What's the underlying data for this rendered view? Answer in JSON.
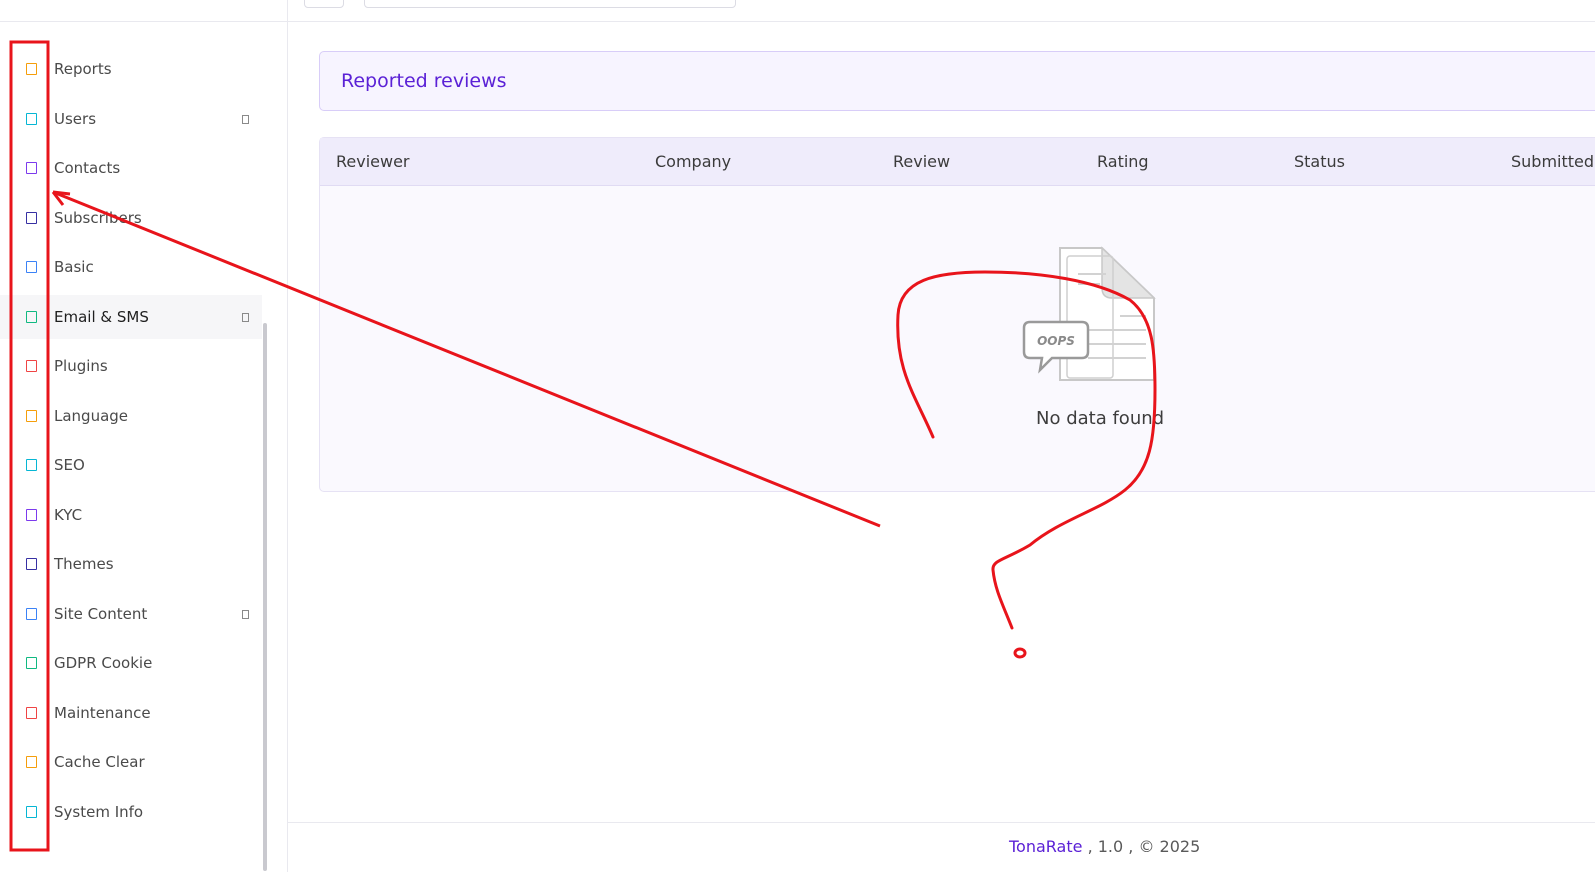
{
  "sidebar": {
    "items": [
      {
        "label": "Reports",
        "color": "#f59e0b"
      },
      {
        "label": "Users",
        "color": "#06b6d4",
        "has_submenu": true
      },
      {
        "label": "Contacts",
        "color": "#7c3aed"
      },
      {
        "label": "Subscribers",
        "color": "#3730a3"
      },
      {
        "label": "Basic",
        "color": "#3b82f6"
      },
      {
        "label": "Email & SMS",
        "color": "#10b981",
        "has_submenu": true,
        "active": true
      },
      {
        "label": "Plugins",
        "color": "#ef4444"
      },
      {
        "label": "Language",
        "color": "#f59e0b"
      },
      {
        "label": "SEO",
        "color": "#06b6d4"
      },
      {
        "label": "KYC",
        "color": "#7c3aed"
      },
      {
        "label": "Themes",
        "color": "#3730a3"
      },
      {
        "label": "Site Content",
        "color": "#3b82f6",
        "has_submenu": true
      },
      {
        "label": "GDPR Cookie",
        "color": "#10b981"
      },
      {
        "label": "Maintenance",
        "color": "#ef4444"
      },
      {
        "label": "Cache Clear",
        "color": "#f59e0b"
      },
      {
        "label": "System Info",
        "color": "#06b6d4"
      }
    ]
  },
  "page": {
    "title": "Reported reviews"
  },
  "table": {
    "columns": [
      "Reviewer",
      "Company",
      "Review",
      "Rating",
      "Status",
      "Submitted"
    ],
    "empty_badge": "OOPS",
    "empty_text": "No data found"
  },
  "footer": {
    "brand": "TonaRate",
    "rest": " , 1.0 , © 2025"
  },
  "colors": {
    "accent": "#5b21d6",
    "annotation": "#e8141b"
  }
}
